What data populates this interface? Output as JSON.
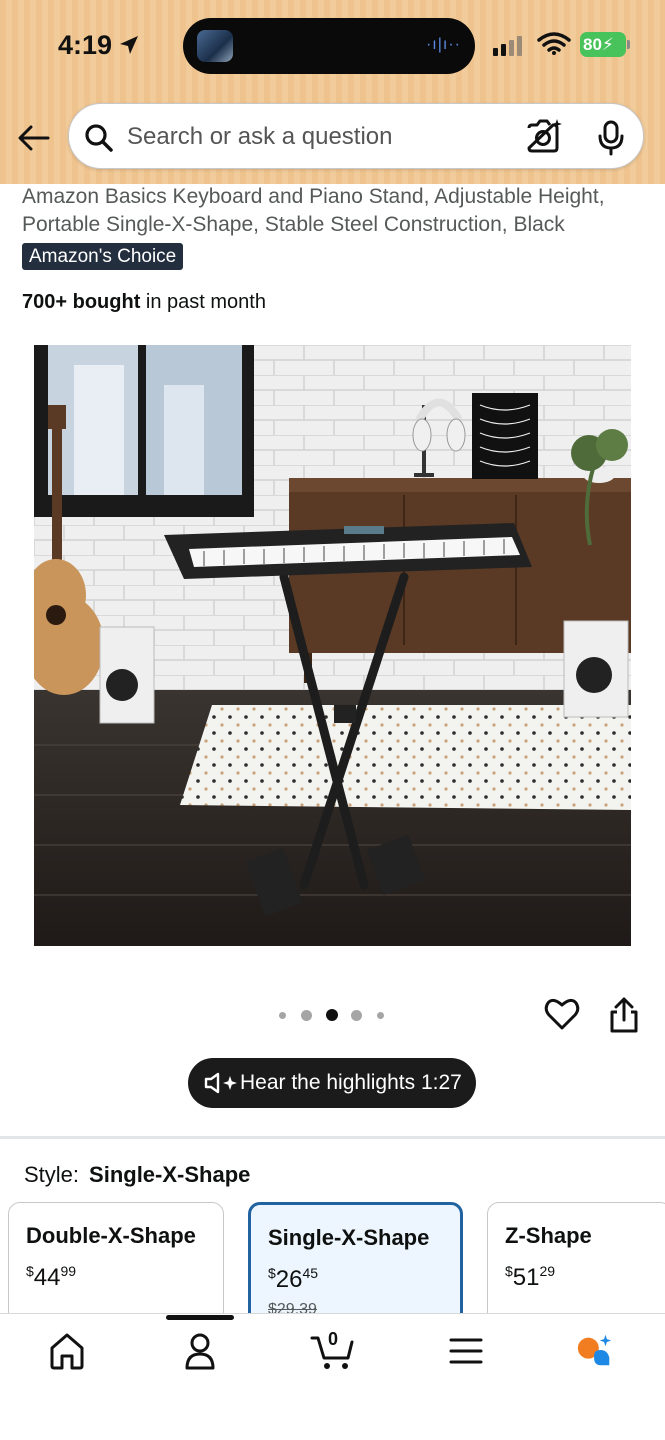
{
  "status_bar": {
    "time": "4:19",
    "battery": "80",
    "icons": [
      "location-arrow-icon",
      "signal-icon",
      "wifi-icon",
      "battery-icon"
    ]
  },
  "search": {
    "placeholder": "Search or ask a question"
  },
  "product": {
    "title": "Amazon Basics Keyboard and Piano Stand, Adjustable Height, Portable Single-X-Shape, Stable Steel Construction, Black",
    "badge": "Amazon's Choice",
    "bought_count": "700+ bought",
    "bought_suffix": " in past month",
    "carousel": {
      "total": 5,
      "active_index": 2
    }
  },
  "highlights": {
    "label": "Hear the highlights 1:27"
  },
  "style": {
    "label": "Style:",
    "selected": "Single-X-Shape",
    "options": [
      {
        "name": "Double-X-Shape",
        "currency": "$",
        "price_whole": "44",
        "price_cents": "99",
        "old_price": ""
      },
      {
        "name": "Single-X-Shape",
        "currency": "$",
        "price_whole": "26",
        "price_cents": "45",
        "old_price": "$29.39"
      },
      {
        "name": "Z-Shape",
        "currency": "$",
        "price_whole": "51",
        "price_cents": "29",
        "old_price": ""
      }
    ]
  },
  "bottom_nav": {
    "items": [
      "home-icon",
      "account-icon",
      "cart-icon",
      "menu-icon",
      "rufus-icon"
    ],
    "cart_count": "0"
  },
  "colors": {
    "header_bg": "#EFC38E",
    "badge_bg": "#232F3E",
    "selected_border": "#2162A1",
    "selected_bg": "#EDF6FE",
    "rufus_orange": "#F27D20",
    "rufus_blue": "#1E88E5"
  }
}
